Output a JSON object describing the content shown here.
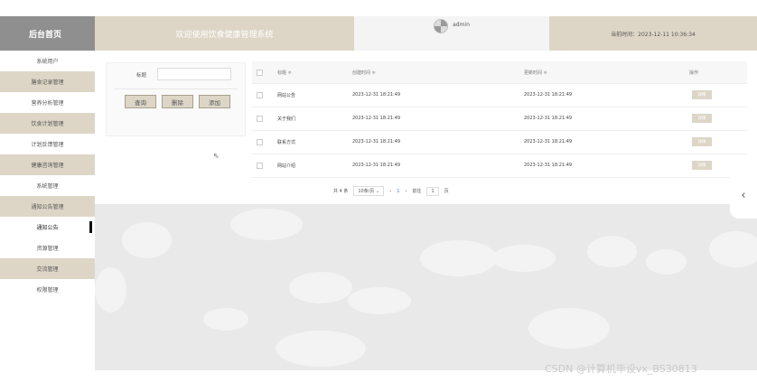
{
  "header": {
    "brand": "后台首页",
    "welcome": "欢迎使用饮食健康管理系统",
    "username": "admin",
    "time_text": "当前时间：2023-12-11 10:36:34"
  },
  "sidebar": {
    "items": [
      {
        "label": "系统用户"
      },
      {
        "label": "膳食记录管理"
      },
      {
        "label": "营养分析管理"
      },
      {
        "label": "饮食计划管理"
      },
      {
        "label": "计划反馈管理"
      },
      {
        "label": "健康咨询管理"
      },
      {
        "label": "系统管理"
      },
      {
        "label": "通知公告管理"
      },
      {
        "label": "通知公告"
      },
      {
        "label": "资源管理"
      },
      {
        "label": "交流管理"
      },
      {
        "label": "权限管理"
      }
    ]
  },
  "search": {
    "title_label": "标题",
    "title_value": "",
    "query_btn": "查询",
    "delete_btn": "删除",
    "add_btn": "添加"
  },
  "table": {
    "headers": {
      "title": "标题 ≑",
      "created": "创建时间 ≑",
      "updated": "更新时间 ≑",
      "action": "操作"
    },
    "rows": [
      {
        "title": "网站公告",
        "created": "2023-12-31 18:21:49",
        "updated": "2023-12-31 18:21:49",
        "action": "详情"
      },
      {
        "title": "关于我们",
        "created": "2023-12-31 18:21:49",
        "updated": "2023-12-31 18:21:49",
        "action": "详情"
      },
      {
        "title": "联系方式",
        "created": "2023-12-31 18:21:49",
        "updated": "2023-12-31 18:21:49",
        "action": "详情"
      },
      {
        "title": "网站介绍",
        "created": "2023-12-31 18:21:49",
        "updated": "2023-12-31 18:21:49",
        "action": "详情"
      }
    ]
  },
  "pager": {
    "total": "共 4 条",
    "page_size": "10条/页",
    "prev": "‹",
    "current": "1",
    "next": "›",
    "goto_label": "前往",
    "goto_value": "1",
    "page_unit": "页"
  },
  "collapse_icon": "chevron-left-icon",
  "watermark": "CSDN @计算机毕设vx_BS30813",
  "colors": {
    "accent": "#ddd6c7",
    "brand_bg": "#8f8f8f",
    "main_bg": "#e9e9e9"
  }
}
